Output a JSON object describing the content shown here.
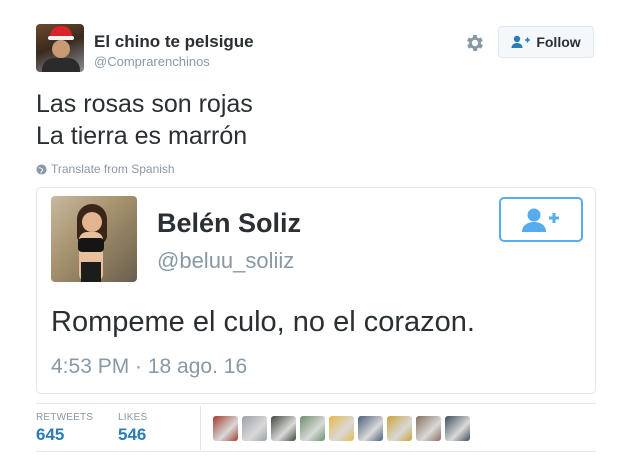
{
  "author": {
    "display_name": "El chino te pelsigue",
    "username": "@Comprarenchinos"
  },
  "actions": {
    "settings_icon": "gear-icon",
    "follow_label": "Follow",
    "follow_icon": "user-add-icon"
  },
  "tweet": {
    "lines": [
      "Las rosas son rojas",
      "La tierra es marrón"
    ],
    "translate_label": "Translate from Spanish",
    "translate_icon": "globe-icon"
  },
  "quoted": {
    "name": "Belén Soliz",
    "username": "@beluu_soliiz",
    "text": "Rompeme el culo, no el corazon.",
    "timestamp": "4:53 PM · 18 ago. 16",
    "follow_icon": "user-add-icon"
  },
  "stats": {
    "retweets_label": "RETWEETS",
    "retweets_value": "645",
    "likes_label": "LIKES",
    "likes_value": "546"
  },
  "likers": [
    {
      "name": "liker-avatar-1",
      "color": "#a23a2e"
    },
    {
      "name": "liker-avatar-2",
      "color": "#9aa1a8"
    },
    {
      "name": "liker-avatar-3",
      "color": "#3f4a3a"
    },
    {
      "name": "liker-avatar-4",
      "color": "#6b8f6a"
    },
    {
      "name": "liker-avatar-5",
      "color": "#e8b84a"
    },
    {
      "name": "liker-avatar-6",
      "color": "#4a5f7a"
    },
    {
      "name": "liker-avatar-7",
      "color": "#c9a43c"
    },
    {
      "name": "liker-avatar-8",
      "color": "#8a6f5e"
    },
    {
      "name": "liker-avatar-9",
      "color": "#3c4e5c"
    }
  ],
  "colors": {
    "accent": "#2b7bb9",
    "follow_border": "#55acee",
    "muted": "#8899a6",
    "text": "#292f33"
  }
}
